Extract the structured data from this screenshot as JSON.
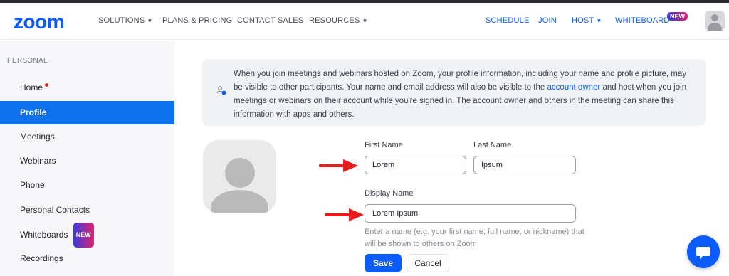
{
  "brand": {
    "logo": "zoom",
    "accent": "#0b5cff"
  },
  "top_nav": {
    "left": [
      {
        "label": "SOLUTIONS",
        "dropdown": true
      },
      {
        "label": "PLANS & PRICING",
        "dropdown": false
      },
      {
        "label": "CONTACT SALES",
        "dropdown": false
      },
      {
        "label": "RESOURCES",
        "dropdown": true
      }
    ],
    "right": [
      {
        "label": "SCHEDULE"
      },
      {
        "label": "JOIN"
      },
      {
        "label": "HOST",
        "dropdown": true
      },
      {
        "label": "WHITEBOARD",
        "badge": "NEW"
      }
    ]
  },
  "sidebar": {
    "section": "PERSONAL",
    "items": [
      {
        "label": "Home"
      },
      {
        "label": "Profile"
      },
      {
        "label": "Meetings"
      },
      {
        "label": "Webinars"
      },
      {
        "label": "Phone"
      },
      {
        "label": "Personal Contacts"
      },
      {
        "label": "Whiteboards",
        "badge": "NEW"
      },
      {
        "label": "Recordings"
      }
    ]
  },
  "notice": {
    "before": "When you join meetings and webinars hosted on Zoom, your profile information, including your name and profile picture, may be visible to other participants. Your name and email address will also be visible to the ",
    "link": "account owner",
    "after": " and host when you join meetings or webinars on their account while you're signed in. The account owner and others in the meeting can share this information with apps and others."
  },
  "form": {
    "first_name_label": "First Name",
    "first_name_value": "Lorem",
    "last_name_label": "Last Name",
    "last_name_value": "Ipsum",
    "display_name_label": "Display Name",
    "display_name_value": "Lorem Ipsum",
    "hint": "Enter a name (e.g. your first name, full name, or nickname) that will be shown to others on Zoom",
    "save": "Save",
    "cancel": "Cancel"
  },
  "icons": [
    "chevron-down-icon",
    "user-avatar-icon",
    "profile-placeholder-icon",
    "info-person-icon",
    "red-arrow-icon",
    "chat-bubble-icon"
  ],
  "colors": {
    "active_item": "#0e72ed",
    "arrow": "#e81c1c"
  }
}
